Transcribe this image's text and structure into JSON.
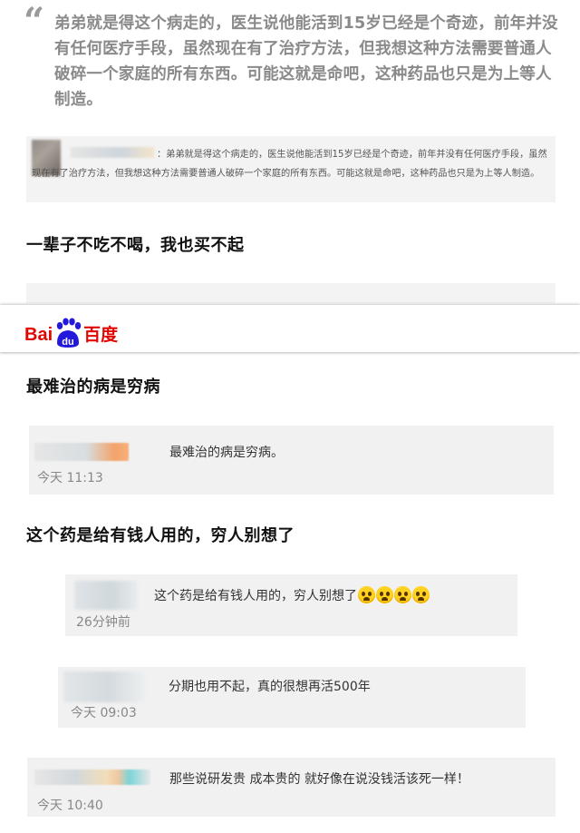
{
  "quote": {
    "mark": "“",
    "text": "弟弟就是得这个病走的，医生说他能活到15岁已经是个奇迹，前年并没有任何医疗手段，虽然现在有了治疗方法，但我想这种方法需要普通人破碎一个家庭的所有东西。可能这就是命吧，这种药品也只是为上等人制造。"
  },
  "small_comment": {
    "text": "：弟弟就是得这个病走的，医生说他能活到15岁已经是个奇迹，前年并没有任何医疗手段，虽然现在有了治疗方法，但我想这种方法需要普通人破碎一个家庭的所有东西。可能这就是命吧，这种药品也只是为上等人制造。"
  },
  "headings": {
    "h1": "一辈子不吃不喝，我也买不起",
    "h2": "最难治的病是穷病",
    "h3": "这个药是给有钱人用的，穷人别想了"
  },
  "banner": {
    "logo_bai": "Bai",
    "logo_du": "du",
    "logo_cn": "百度"
  },
  "comments": [
    {
      "text": "最难治的病是穷病。",
      "time": "今天 11:13"
    },
    {
      "text": "这个药是给有钱人用的，穷人别想了",
      "time": "26分钟前",
      "emoji_count": 4
    },
    {
      "text": "分期也用不起，真的很想再活500年",
      "time": "今天 09:03"
    },
    {
      "text": "那些说研发贵 成本贵的 就好像在说没钱活该死一样！",
      "time": "今天 10:40"
    }
  ],
  "colors": {
    "baidu_red": "#e10601",
    "baidu_blue": "#2319dc",
    "card_bg": "#f1f1f1"
  }
}
